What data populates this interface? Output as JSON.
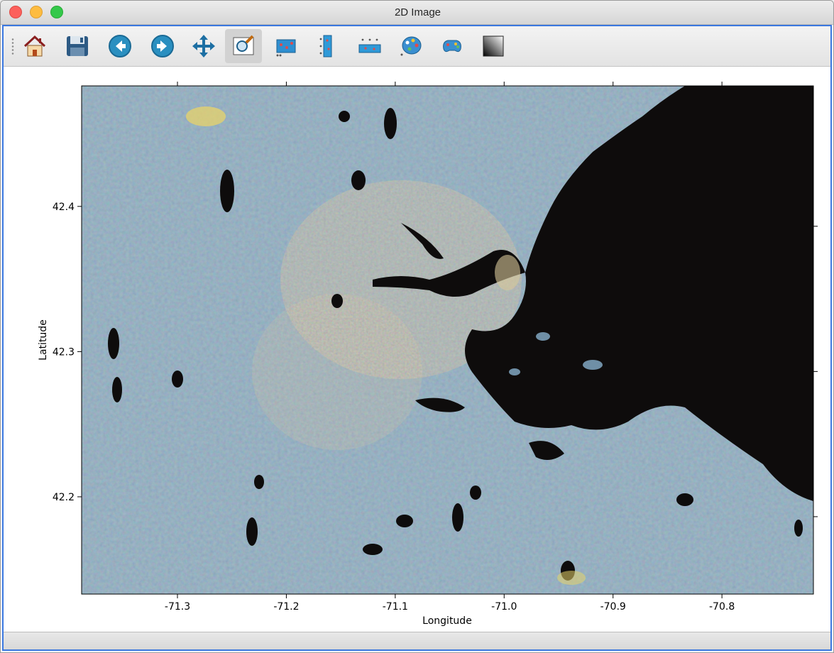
{
  "window": {
    "title": "2D Image"
  },
  "toolbar": {
    "buttons": [
      {
        "name": "home-button",
        "icon": "home-icon"
      },
      {
        "name": "save-button",
        "icon": "floppy-disk-icon"
      },
      {
        "name": "back-button",
        "icon": "arrow-left-icon"
      },
      {
        "name": "forward-button",
        "icon": "arrow-right-icon"
      },
      {
        "name": "pan-button",
        "icon": "move-arrows-icon"
      },
      {
        "name": "zoom-button",
        "icon": "zoom-rect-icon",
        "active": true
      },
      {
        "name": "configure-plot-button",
        "icon": "configure-plot-icon"
      },
      {
        "name": "colorbar-vertical-button",
        "icon": "colorbar-vertical-icon"
      },
      {
        "name": "colorbar-horizontal-button",
        "icon": "colorbar-horizontal-icon"
      },
      {
        "name": "colormap-button",
        "icon": "palette-icon"
      },
      {
        "name": "colormap-edit-button",
        "icon": "gamepad-palette-icon"
      },
      {
        "name": "grayscale-button",
        "icon": "gradient-square-icon"
      }
    ]
  },
  "colors": {
    "water": "#0e0c0c",
    "land": "#6f8fa6",
    "urban": "#b89a6a",
    "frame_accent": "#3b78e0"
  },
  "chart_data": {
    "type": "heatmap",
    "title": "",
    "xlabel": "Longitude",
    "ylabel": "Latitude",
    "xlim": [
      -71.388,
      -70.716
    ],
    "ylim": [
      42.133,
      42.483
    ],
    "xticks": [
      -71.3,
      -71.2,
      -71.1,
      -71.0,
      -70.9,
      -70.8
    ],
    "xtick_labels": [
      "-71.3",
      "-71.2",
      "-71.1",
      "-71.0",
      "-70.9",
      "-70.8"
    ],
    "yticks": [
      42.2,
      42.3,
      42.4
    ],
    "ytick_labels": [
      "42.2",
      "42.3",
      "42.4"
    ],
    "content": "false-color satellite image of the Boston area; black water of Massachusetts Bay on the right"
  }
}
